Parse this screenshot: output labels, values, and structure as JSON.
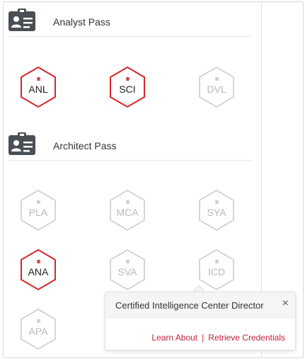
{
  "sections": [
    {
      "title": "Analyst Pass",
      "icon": "id-card-icon",
      "badges": [
        {
          "code": "ANL",
          "state": "earned"
        },
        {
          "code": "SCI",
          "state": "earned"
        },
        {
          "code": "DVL",
          "state": "not-earned"
        }
      ]
    },
    {
      "title": "Architect Pass",
      "icon": "id-card-icon",
      "badges": [
        {
          "code": "PLA",
          "state": "not-earned"
        },
        {
          "code": "MCA",
          "state": "not-earned"
        },
        {
          "code": "SYA",
          "state": "not-earned"
        },
        {
          "code": "ANA",
          "state": "earned"
        },
        {
          "code": "SVA",
          "state": "not-earned"
        },
        {
          "code": "ICD",
          "state": "not-earned"
        },
        {
          "code": "APA",
          "state": "not-earned"
        }
      ]
    }
  ],
  "popover": {
    "title": "Certified Intelligence Center Director",
    "close_glyph": "×",
    "learn_label": "Learn About",
    "separator": "|",
    "retrieve_label": "Retrieve Credentials"
  },
  "colors": {
    "earned_border": "#d7262d",
    "not_earned_border": "#c8c8c8",
    "link": "#c21f39",
    "icon_fill": "#4a4f55"
  },
  "badge_mark": "ııı"
}
